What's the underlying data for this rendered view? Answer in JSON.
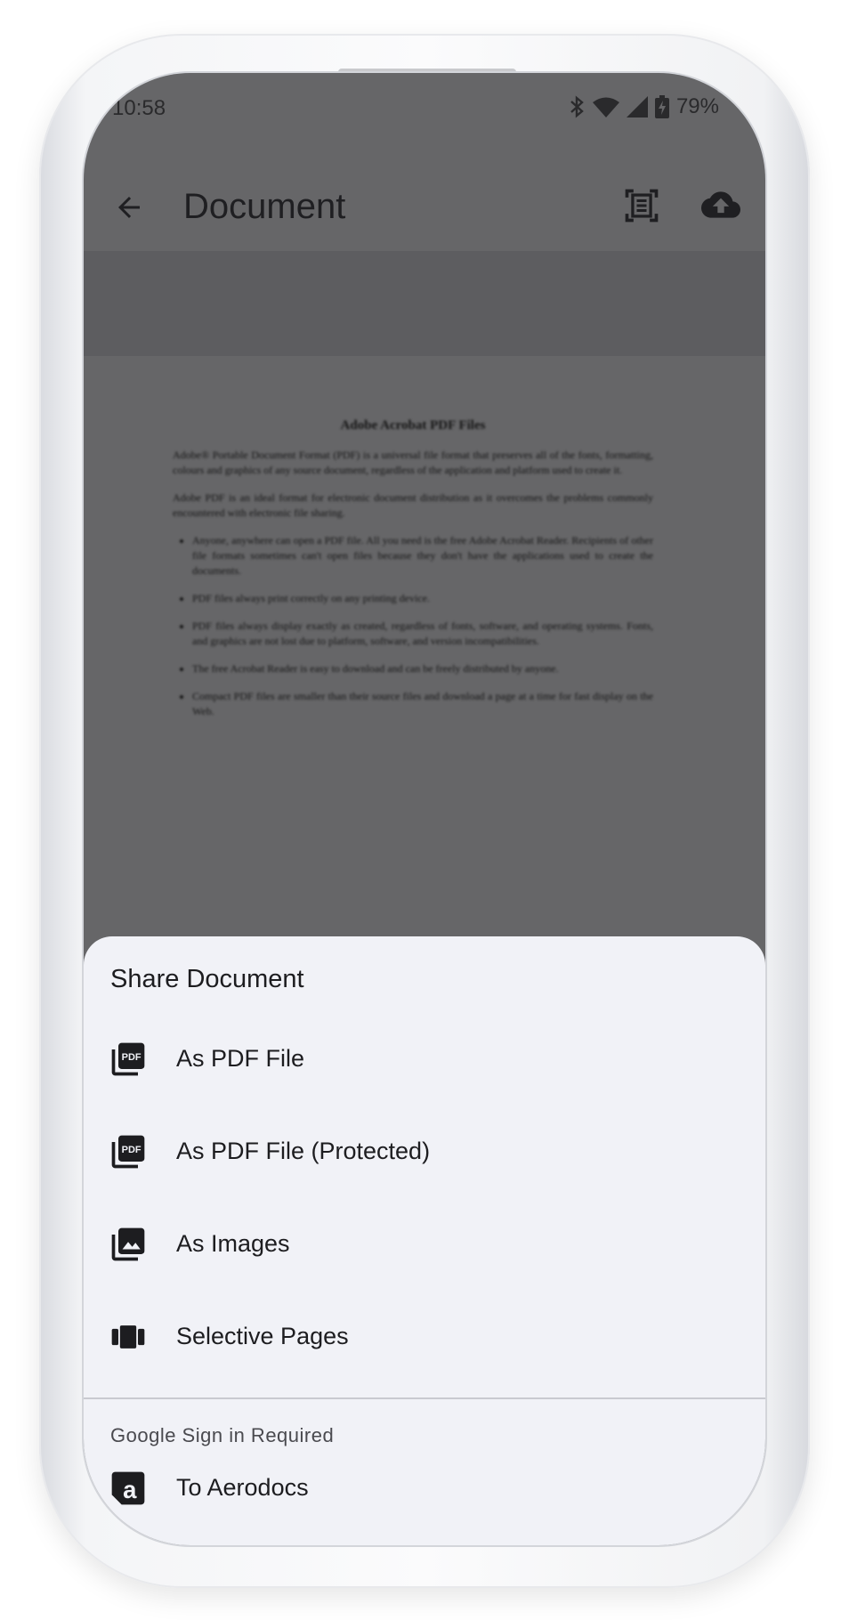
{
  "status_bar": {
    "time": "10:58",
    "battery_percent": "79%",
    "icons": [
      "bluetooth-icon",
      "wifi-icon",
      "signal-icon",
      "battery-charging-icon"
    ]
  },
  "app_bar": {
    "title": "Document",
    "back_icon": "arrow-back-icon",
    "actions": [
      "document-scanner-icon",
      "cloud-upload-icon"
    ]
  },
  "document_preview": {
    "title": "Adobe Acrobat PDF Files",
    "paragraphs": [
      "Adobe® Portable Document Format (PDF) is a universal file format that preserves all of the fonts, formatting, colours and graphics of any source document, regardless of the application and platform used to create it.",
      "Adobe PDF is an ideal format for electronic document distribution as it overcomes the problems commonly encountered with electronic file sharing."
    ],
    "bullets": [
      "Anyone, anywhere can open a PDF file. All you need is the free Adobe Acrobat Reader. Recipients of other file formats sometimes can't open files because they don't have the applications used to create the documents.",
      "PDF files always print correctly on any printing device.",
      "PDF files always display exactly as created, regardless of fonts, software, and operating systems. Fonts, and graphics are not lost due to platform, software, and version incompatibilities.",
      "The free Acrobat Reader is easy to download and can be freely distributed by anyone.",
      "Compact PDF files are smaller than their source files and download a page at a time for fast display on the Web."
    ]
  },
  "share_sheet": {
    "title": "Share Document",
    "items": [
      {
        "label": "As PDF File",
        "icon": "pdf-file-icon"
      },
      {
        "label": "As PDF File (Protected)",
        "icon": "pdf-protected-icon"
      },
      {
        "label": "As Images",
        "icon": "images-icon"
      },
      {
        "label": "Selective Pages",
        "icon": "pages-carousel-icon"
      }
    ],
    "section_label": "Google Sign in Required",
    "aerodocs_item": {
      "label": "To Aerodocs",
      "icon": "aerodocs-logo-icon"
    }
  },
  "colors": {
    "scrim": "#666668",
    "sheet_background": "#f1f2f7",
    "text_primary": "#1d1d20",
    "icon": "#1d1d20"
  }
}
